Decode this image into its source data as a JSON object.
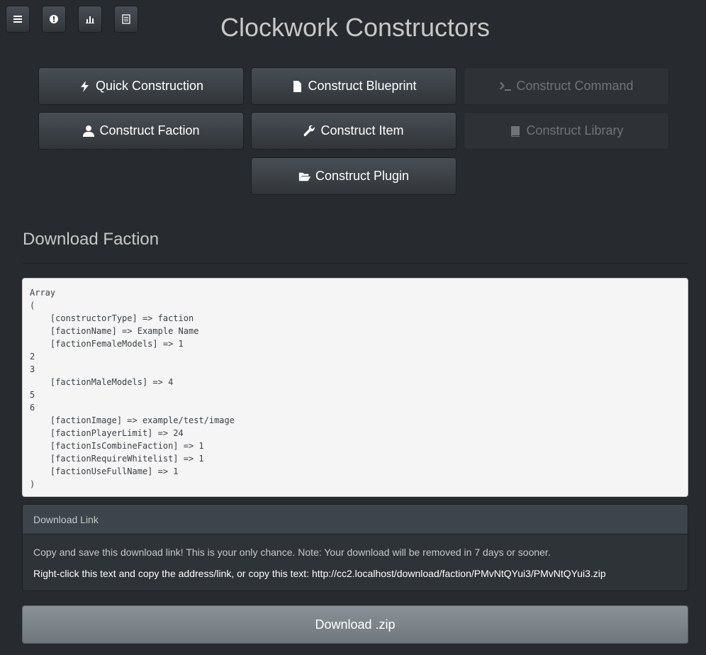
{
  "header": {
    "title": "Clockwork Constructors",
    "icon_buttons": [
      {
        "icon": "menu-icon"
      },
      {
        "icon": "info-icon"
      },
      {
        "icon": "stats-icon"
      },
      {
        "icon": "list-icon"
      }
    ]
  },
  "constructors": {
    "quick": {
      "label": "Quick Construction",
      "icon": "bolt-icon"
    },
    "blueprint": {
      "label": "Construct Blueprint",
      "icon": "file-icon"
    },
    "command": {
      "label": "Construct Command",
      "icon": "terminal-icon",
      "disabled": true
    },
    "faction": {
      "label": "Construct Faction",
      "icon": "user-icon"
    },
    "item": {
      "label": "Construct Item",
      "icon": "wrench-icon"
    },
    "library": {
      "label": "Construct Library",
      "icon": "book-icon",
      "disabled": true
    },
    "plugin": {
      "label": "Construct Plugin",
      "icon": "folder-open-icon"
    }
  },
  "section": {
    "title": "Download Faction"
  },
  "output": {
    "text": "Array\n(\n    [constructorType] => faction\n    [factionName] => Example Name\n    [factionFemaleModels] => 1\n2\n3\n    [factionMaleModels] => 4\n5\n6\n    [factionImage] => example/test/image\n    [factionPlayerLimit] => 24\n    [factionIsCombineFaction] => 1\n    [factionRequireWhitelist] => 1\n    [factionUseFullName] => 1\n)"
  },
  "download_panel": {
    "heading": "Download Link",
    "notice": "Copy and save this download link! This is your only chance. Note: Your download will be removed in 7 days or sooner.",
    "link_text": "Right-click this text and copy the address/link, or copy this text: http://cc2.localhost/download/faction/PMvNtQYui3/PMvNtQYui3.zip"
  },
  "download_button": {
    "label": "Download .zip"
  },
  "colors": {
    "background": "#272b30",
    "button": "#3a3f44",
    "download_button": "#7a8288",
    "code_bg": "#f5f5f5"
  }
}
